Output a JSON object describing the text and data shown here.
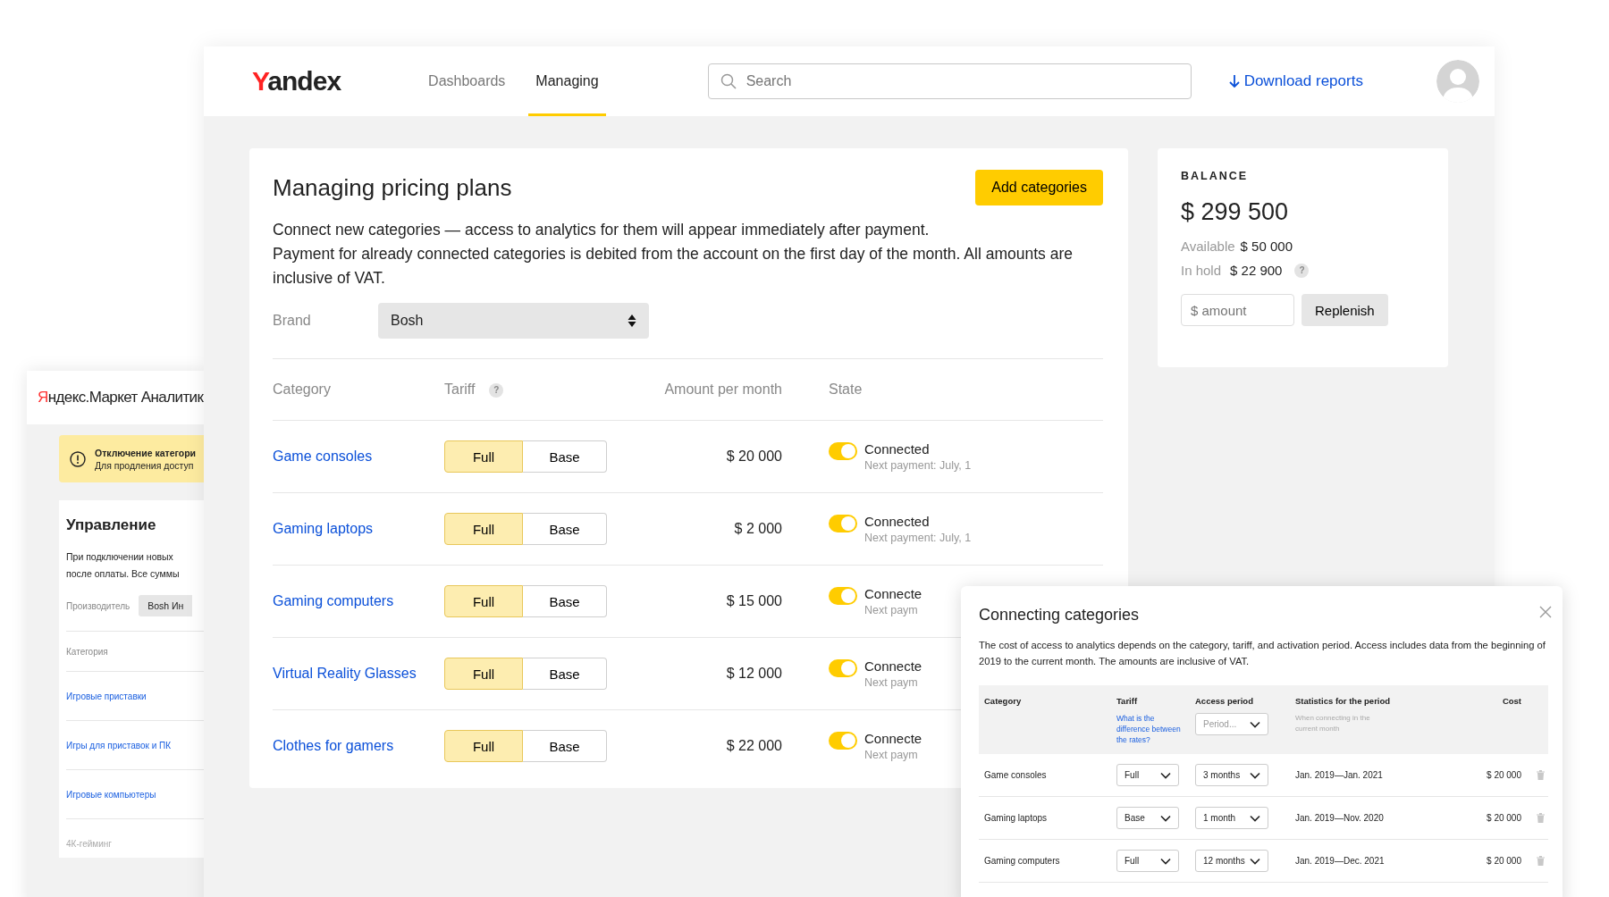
{
  "back_window": {
    "logo": "Яндекс.Маркет Аналитик",
    "notice": {
      "title": "Отключение категори",
      "text": "Для продления доступ"
    },
    "title": "Управление",
    "description": [
      "При подключении новых",
      "после оплаты. Все суммы"
    ],
    "maker_label": "Производитель",
    "maker_value": "Bosh Ин",
    "column": "Категория",
    "items": [
      {
        "label": "Игровые приставки",
        "disabled": false
      },
      {
        "label": "Игры для приставок и ПК",
        "disabled": false
      },
      {
        "label": "Игровые компьютеры",
        "disabled": false
      },
      {
        "label": "4К-гейминг",
        "disabled": true
      }
    ]
  },
  "main_window": {
    "logo": "Yandex",
    "nav": [
      {
        "label": "Dashboards",
        "selected": false
      },
      {
        "label": "Managing",
        "selected": true
      }
    ],
    "search": {
      "placeholder": "Search"
    },
    "download_link": "Download reports"
  },
  "pricing": {
    "title": "Managing pricing plans",
    "add_button": "Add categories",
    "description": [
      "Connect new categories — access to analytics for them will appear immediately after payment.",
      "Payment for already connected categories is debited from the account on the first day of the month. All amounts are inclusive of VAT."
    ],
    "brand": {
      "label": "Brand",
      "value": "Bosh"
    },
    "columns": [
      "Category",
      "Tariff",
      "Amount per month",
      "State"
    ],
    "tariff_help": "?",
    "rows": [
      {
        "category": "Game consoles",
        "tariffs": [
          {
            "label": "Full",
            "selected": true
          },
          {
            "label": "Base",
            "selected": false
          }
        ],
        "amount": "$ 20 000",
        "on": true,
        "state": "Connected",
        "next_payment": "Next payment: July, 1"
      },
      {
        "category": "Gaming laptops",
        "tariffs": [
          {
            "label": "Full",
            "selected": true
          },
          {
            "label": "Base",
            "selected": false
          }
        ],
        "amount": "$ 2 000",
        "on": true,
        "state": "Connected",
        "next_payment": "Next payment: July, 1"
      },
      {
        "category": "Gaming computers",
        "tariffs": [
          {
            "label": "Full",
            "selected": true
          },
          {
            "label": "Base",
            "selected": false
          }
        ],
        "amount": "$ 15 000",
        "on": true,
        "state": "Connecte",
        "next_payment": "Next paym"
      },
      {
        "category": "Virtual Reality Glasses",
        "tariffs": [
          {
            "label": "Full",
            "selected": true
          },
          {
            "label": "Base",
            "selected": false
          }
        ],
        "amount": "$ 12 000",
        "on": true,
        "state": "Connecte",
        "next_payment": "Next paym"
      },
      {
        "category": "Clothes for gamers",
        "tariffs": [
          {
            "label": "Full",
            "selected": true
          },
          {
            "label": "Base",
            "selected": false
          }
        ],
        "amount": "$ 22 000",
        "on": true,
        "state": "Connecte",
        "next_payment": "Next paym"
      }
    ]
  },
  "balance": {
    "title": "BALANCE",
    "total": "$ 299 500",
    "available_label": "Available",
    "available": "$ 50 000",
    "hold_label": "In hold",
    "hold": "$ 22 900",
    "hold_help": "?",
    "amount_placeholder": "$ amount",
    "button": "Replenish"
  },
  "dialog": {
    "title": "Connecting categories",
    "description": "The cost of access to analytics depends on the category, tariff, and activation period. Access includes data from the beginning of 2019 to the current month. The amounts are inclusive of VAT.",
    "columns": [
      "Category",
      "Tariff",
      "Access period",
      "Statistics for the period",
      "Cost"
    ],
    "tariff_link": "What is the difference between the rates?",
    "period_placeholder": "Period...",
    "period_hint": "When connecting in the current month",
    "rows": [
      {
        "category": "Game consoles",
        "tariff": "Full",
        "period": "3 months",
        "statistics": "Jan. 2019—Jan. 2021",
        "cost": "$ 20 000"
      },
      {
        "category": "Gaming laptops",
        "tariff": "Base",
        "period": "1 month",
        "statistics": "Jan. 2019—Nov. 2020",
        "cost": "$ 20 000"
      },
      {
        "category": "Gaming computers",
        "tariff": "Full",
        "period": "12 months",
        "statistics": "Jan. 2019—Dec. 2021",
        "cost": "$ 20 000"
      }
    ]
  }
}
